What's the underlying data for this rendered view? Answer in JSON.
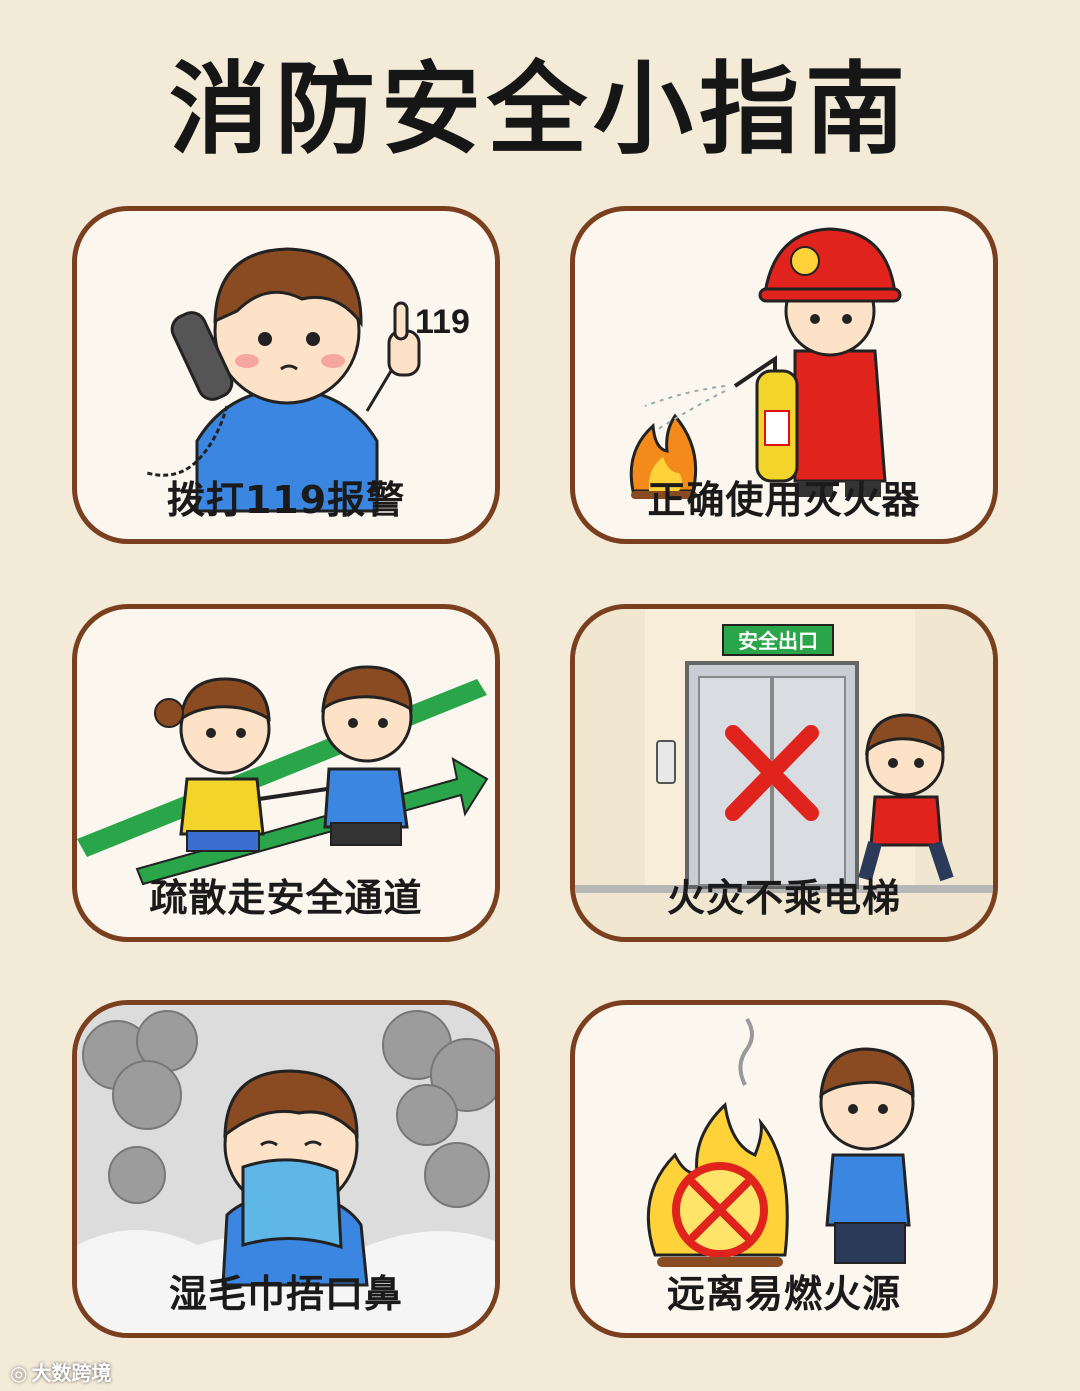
{
  "title": "消防安全小指南",
  "cards": [
    {
      "caption": "拨打119报警",
      "number": "119"
    },
    {
      "caption": "正确使用灭火器"
    },
    {
      "caption": "疏散走安全通道"
    },
    {
      "caption": "火灾不乘电梯",
      "sign": "安全出口"
    },
    {
      "caption": "湿毛巾捂口鼻"
    },
    {
      "caption": "远离易燃火源"
    }
  ],
  "watermark": {
    "text": "大数跨境"
  },
  "colors": {
    "background": "#f3ead8",
    "card_border": "#7a3f1e",
    "fire_red": "#e0231c",
    "exit_green": "#2aa54a"
  },
  "icons": [
    "telephone-icon",
    "fire-extinguisher-icon",
    "exit-arrow-icon",
    "elevator-icon",
    "smoke-icon",
    "no-fire-icon"
  ]
}
